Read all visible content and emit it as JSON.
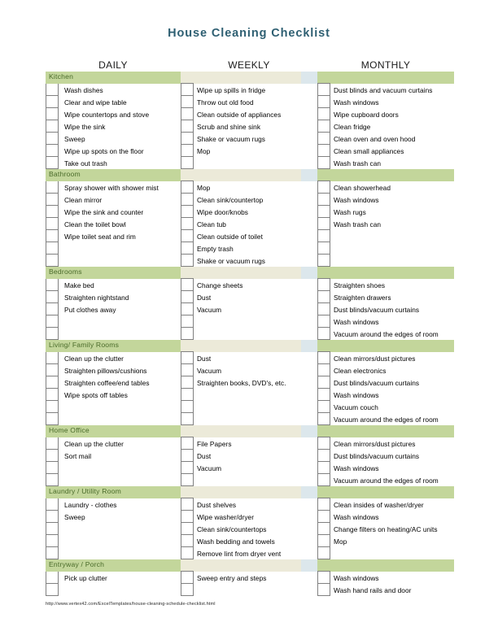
{
  "document": {
    "title": "House Cleaning Checklist",
    "footer_url": "http://www.vertex42.com/ExcelTemplates/house-cleaning-schedule-checklist.html",
    "colors": {
      "title_text": "#2e5f72",
      "band_green": "#c3d69b",
      "band_label_text": "#4a6b2a",
      "band_gap_beige": "#ecead9",
      "band_gap_blue": "#dce7ec",
      "checkbox_border": "#808080"
    }
  },
  "columns": [
    {
      "label": "DAILY"
    },
    {
      "label": "WEEKLY"
    },
    {
      "label": "MONTHLY"
    }
  ],
  "sections": [
    {
      "name": "Kitchen",
      "rows": 7,
      "daily": [
        "Wash dishes",
        "Clear and wipe table",
        "Wipe countertops and stove",
        "Wipe the sink",
        "Sweep",
        "Wipe up spots on the floor",
        "Take out trash"
      ],
      "weekly": [
        "Wipe up spills in fridge",
        "Throw out old food",
        "Clean outside of appliances",
        "Scrub and shine sink",
        "Shake or vacuum rugs",
        "Mop",
        ""
      ],
      "monthly": [
        "Dust blinds and vacuum curtains",
        "Wash windows",
        "Wipe cupboard doors",
        "Clean fridge",
        "Clean oven and oven hood",
        "Clean small appliances",
        "Wash trash can"
      ]
    },
    {
      "name": "Bathroom",
      "rows": 7,
      "daily": [
        "Spray shower with shower mist",
        "Clean mirror",
        "Wipe the sink and counter",
        "Clean the toilet bowl",
        "Wipe toilet seat and rim",
        "",
        ""
      ],
      "weekly": [
        "Mop",
        "Clean sink/countertop",
        "Wipe door/knobs",
        "Clean tub",
        "Clean outside of toilet",
        "Empty trash",
        "Shake or vacuum rugs"
      ],
      "monthly": [
        "Clean showerhead",
        "Wash windows",
        "Wash rugs",
        "Wash trash can",
        "",
        "",
        ""
      ]
    },
    {
      "name": "Bedrooms",
      "rows": 5,
      "daily": [
        "Make bed",
        "Straighten nightstand",
        "Put clothes away",
        "",
        ""
      ],
      "weekly": [
        "Change sheets",
        "Dust",
        "Vacuum",
        "",
        ""
      ],
      "monthly": [
        "Straighten shoes",
        "Straighten drawers",
        "Dust blinds/vacuum curtains",
        "Wash windows",
        "Vacuum around the edges of room"
      ]
    },
    {
      "name": "Living/ Family Rooms",
      "rows": 6,
      "daily": [
        "Clean up the clutter",
        "Straighten pillows/cushions",
        "Straighten coffee/end tables",
        "Wipe spots off tables",
        "",
        ""
      ],
      "weekly": [
        "Dust",
        "Vacuum",
        "Straighten books, DVD's, etc.",
        "",
        "",
        ""
      ],
      "monthly": [
        "Clean mirrors/dust pictures",
        "Clean electronics",
        "Dust blinds/vacuum curtains",
        "Wash windows",
        "Vacuum couch",
        "Vacuum around the edges of room"
      ]
    },
    {
      "name": "Home Office",
      "rows": 4,
      "daily": [
        "Clean up the clutter",
        "Sort mail",
        "",
        ""
      ],
      "weekly": [
        "File Papers",
        "Dust",
        "Vacuum",
        ""
      ],
      "monthly": [
        "Clean mirrors/dust pictures",
        "Dust blinds/vacuum curtains",
        "Wash windows",
        "Vacuum around the edges of room"
      ]
    },
    {
      "name": "Laundry / Utility Room",
      "rows": 5,
      "daily": [
        "Laundry - clothes",
        "Sweep",
        "",
        "",
        ""
      ],
      "weekly": [
        "Dust shelves",
        "Wipe washer/dryer",
        "Clean sink/countertops",
        "Wash bedding and towels",
        "Remove lint from dryer vent"
      ],
      "monthly": [
        "Clean insides of washer/dryer",
        "Wash windows",
        "Change filters on heating/AC units",
        "Mop",
        ""
      ]
    },
    {
      "name": "Entryway / Porch",
      "rows": 2,
      "daily": [
        "Pick up clutter",
        ""
      ],
      "weekly": [
        "Sweep entry and steps",
        ""
      ],
      "monthly": [
        "Wash windows",
        "Wash hand rails and door"
      ]
    }
  ]
}
